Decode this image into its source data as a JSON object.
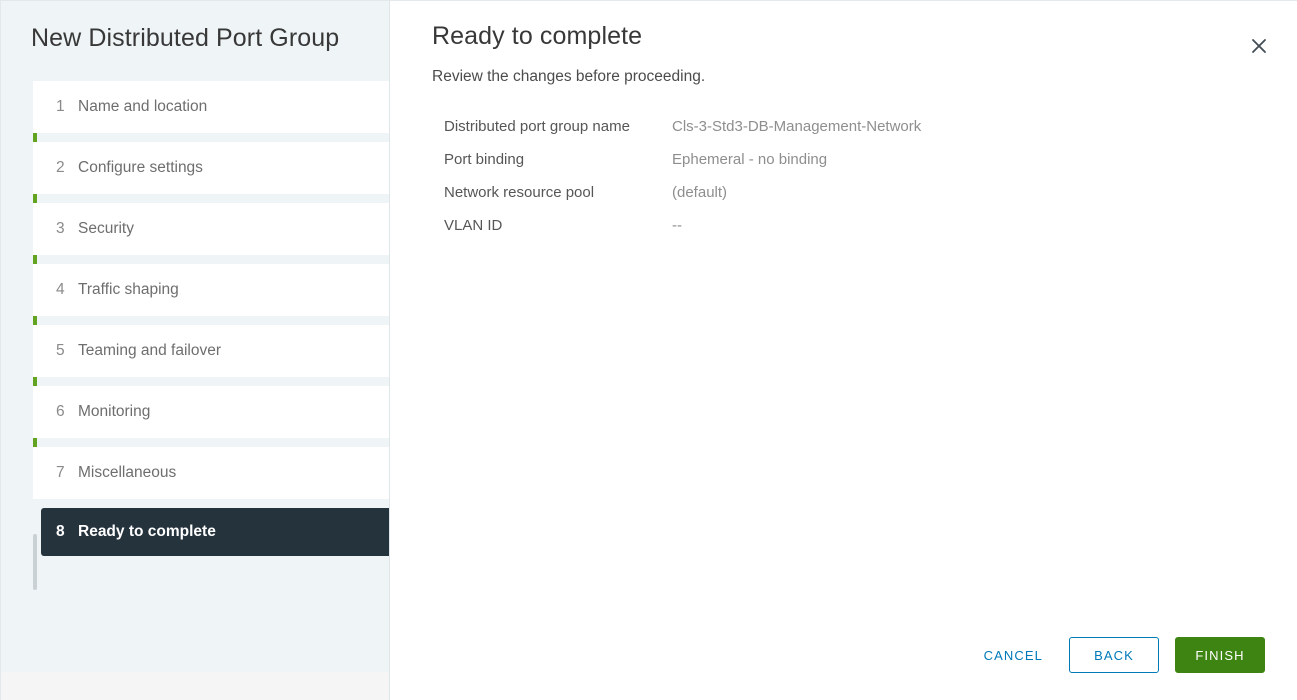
{
  "sidebar": {
    "title": "New Distributed Port Group",
    "steps": [
      {
        "num": "1",
        "label": "Name and location",
        "state": "done"
      },
      {
        "num": "2",
        "label": "Configure settings",
        "state": "done"
      },
      {
        "num": "3",
        "label": "Security",
        "state": "done"
      },
      {
        "num": "4",
        "label": "Traffic shaping",
        "state": "done"
      },
      {
        "num": "5",
        "label": "Teaming and failover",
        "state": "done"
      },
      {
        "num": "6",
        "label": "Monitoring",
        "state": "done"
      },
      {
        "num": "7",
        "label": "Miscellaneous",
        "state": "done"
      },
      {
        "num": "8",
        "label": "Ready to complete",
        "state": "active"
      }
    ]
  },
  "main": {
    "title": "Ready to complete",
    "subtitle": "Review the changes before proceeding.",
    "close_icon": "close-icon",
    "summary": [
      {
        "key": "Distributed port group name",
        "value": "Cls-3-Std3-DB-Management-Network"
      },
      {
        "key": "Port binding",
        "value": "Ephemeral - no binding"
      },
      {
        "key": "Network resource pool",
        "value": "(default)"
      },
      {
        "key": "VLAN ID",
        "value": "--"
      }
    ]
  },
  "footer": {
    "cancel_label": "CANCEL",
    "back_label": "BACK",
    "finish_label": "FINISH"
  },
  "colors": {
    "accent_green": "#62a420",
    "primary_green": "#3d8412",
    "link_blue": "#0079b8",
    "active_step_bg": "#25333d",
    "sidebar_bg": "#eff4f6"
  }
}
